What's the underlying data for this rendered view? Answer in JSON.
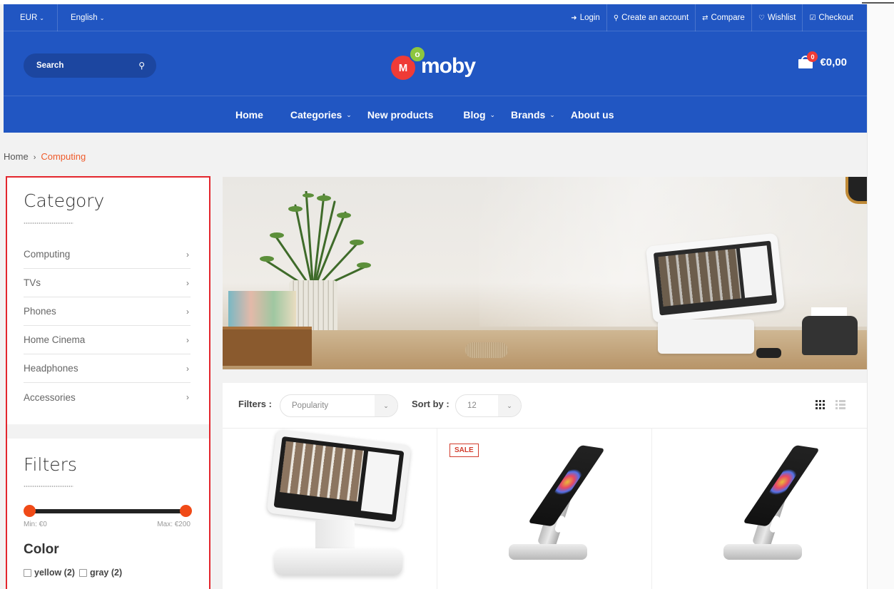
{
  "topbar": {
    "currency": "EUR",
    "language": "English",
    "links": [
      {
        "label": "Login",
        "icon": "sign-in-icon"
      },
      {
        "label": "Create an account",
        "icon": "key-icon"
      },
      {
        "label": "Compare",
        "icon": "exchange-icon"
      },
      {
        "label": "Wishlist",
        "icon": "heart-icon"
      },
      {
        "label": "Checkout",
        "icon": "check-square-icon"
      }
    ]
  },
  "search": {
    "placeholder": "Search"
  },
  "logo": {
    "m_letter": "M",
    "o_letter": "o",
    "text": "moby"
  },
  "cart": {
    "count": "0",
    "total": "€0,00"
  },
  "nav": {
    "items": [
      {
        "label": "Home"
      },
      {
        "label": "Categories"
      },
      {
        "label": "New products"
      },
      {
        "label": "Blog"
      },
      {
        "label": "Brands"
      },
      {
        "label": "About us"
      }
    ]
  },
  "breadcrumb": {
    "home": "Home",
    "separator": "›",
    "current": "Computing"
  },
  "sidebar": {
    "category_title": "Category",
    "categories": [
      "Computing",
      "TVs",
      "Phones",
      "Home Cinema",
      "Headphones",
      "Accessories"
    ],
    "filters_title": "Filters",
    "price": {
      "min_label": "Min: €0",
      "max_label": "Max: €200"
    },
    "color_title": "Color",
    "colors": [
      "yellow (2)",
      "gray (2)"
    ]
  },
  "toolbar": {
    "filters_label": "Filters :",
    "filters_value": "Popularity",
    "sort_label": "Sort by :",
    "sort_value": "12"
  },
  "products": [
    {
      "badge": ""
    },
    {
      "badge": "SALE"
    },
    {
      "badge": ""
    }
  ],
  "colors": {
    "header_blue": "#2156c2",
    "accent_orange": "#ef5b2b",
    "sale_red": "#d23b2c",
    "highlight_border": "#e3262d"
  }
}
